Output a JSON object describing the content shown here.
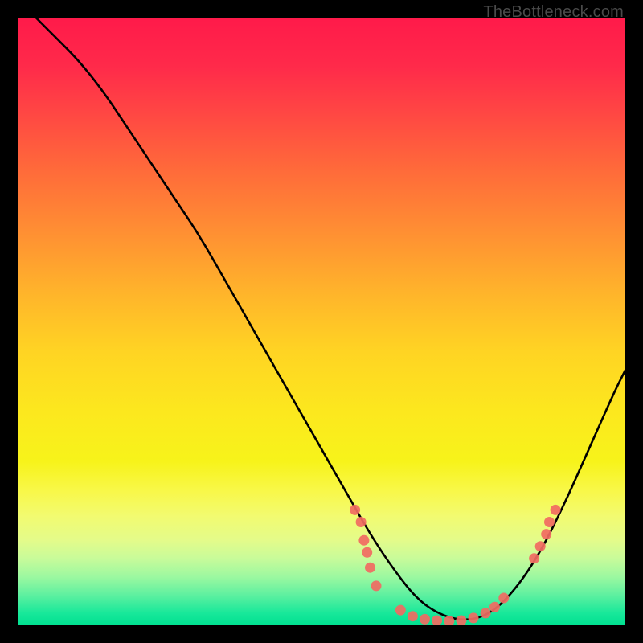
{
  "watermark": "TheBottleneck.com",
  "chart_data": {
    "type": "line",
    "title": "",
    "xlabel": "",
    "ylabel": "",
    "xlim": [
      0,
      100
    ],
    "ylim": [
      0,
      100
    ],
    "curve": {
      "name": "bottleneck-curve",
      "x": [
        3,
        6,
        10,
        14,
        18,
        22,
        26,
        30,
        34,
        38,
        42,
        46,
        50,
        54,
        58,
        62,
        66,
        70,
        74,
        78,
        82,
        86,
        90,
        94,
        98,
        100
      ],
      "y": [
        100,
        97,
        93,
        88,
        82,
        76,
        70,
        64,
        57,
        50,
        43,
        36,
        29,
        22,
        15,
        9,
        4,
        1.5,
        0.7,
        2,
        6,
        12,
        20,
        29,
        38,
        42
      ]
    },
    "markers": {
      "name": "sample-points",
      "color": "#f16a62",
      "points": [
        {
          "x": 55.5,
          "y": 19
        },
        {
          "x": 56.5,
          "y": 17
        },
        {
          "x": 57,
          "y": 14
        },
        {
          "x": 57.5,
          "y": 12
        },
        {
          "x": 58,
          "y": 9.5
        },
        {
          "x": 59,
          "y": 6.5
        },
        {
          "x": 63,
          "y": 2.5
        },
        {
          "x": 65,
          "y": 1.5
        },
        {
          "x": 67,
          "y": 1
        },
        {
          "x": 69,
          "y": 0.8
        },
        {
          "x": 71,
          "y": 0.7
        },
        {
          "x": 73,
          "y": 0.8
        },
        {
          "x": 75,
          "y": 1.2
        },
        {
          "x": 77,
          "y": 2
        },
        {
          "x": 78.5,
          "y": 3
        },
        {
          "x": 80,
          "y": 4.5
        },
        {
          "x": 85,
          "y": 11
        },
        {
          "x": 86,
          "y": 13
        },
        {
          "x": 87,
          "y": 15
        },
        {
          "x": 87.5,
          "y": 17
        },
        {
          "x": 88.5,
          "y": 19
        }
      ]
    }
  }
}
